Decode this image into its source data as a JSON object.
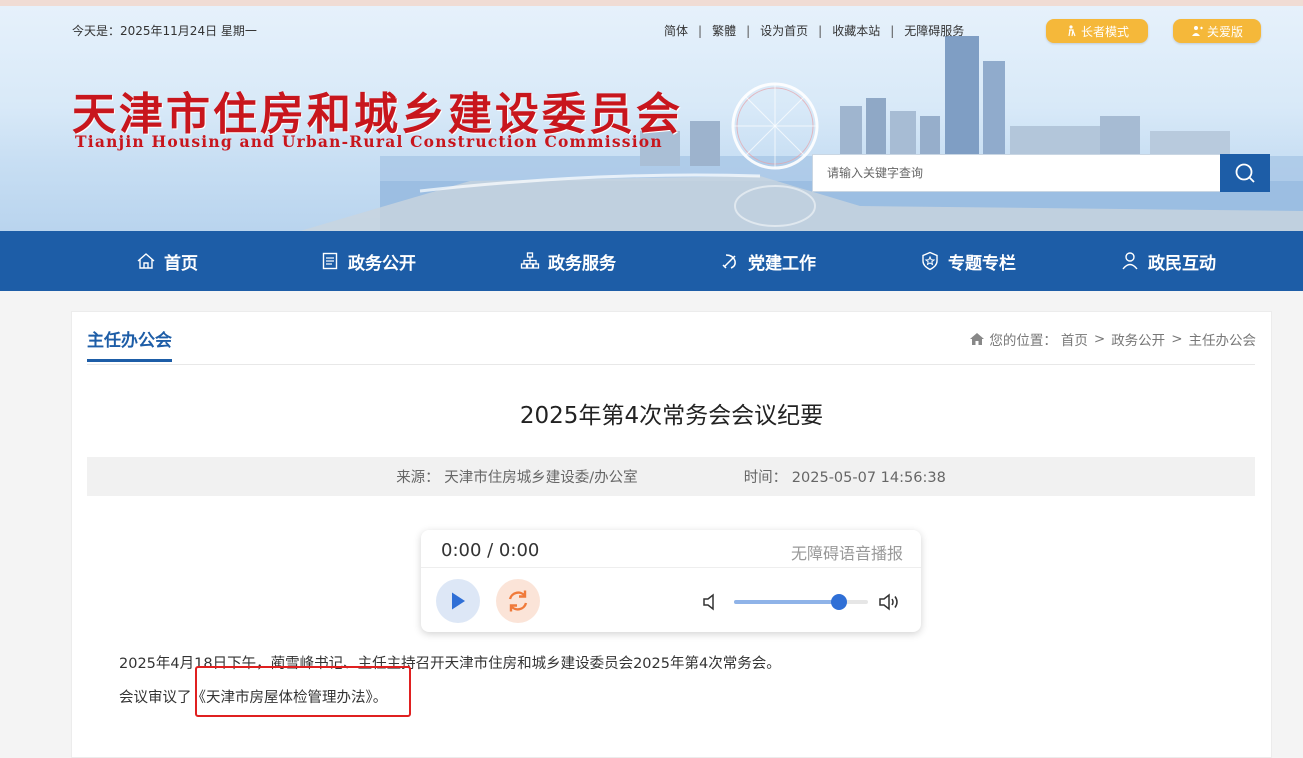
{
  "topbar": {
    "date": "今天是：2025年11月24日 星期一",
    "links": [
      "简体",
      "繁體",
      "设为首页",
      "收藏本站",
      "无障碍服务"
    ],
    "elder_mode": "长者模式",
    "care_version": "关爱版"
  },
  "logo": {
    "cn": "天津市住房和城乡建设委员会",
    "en": "Tianjin Housing and Urban-Rural Construction Commission"
  },
  "search": {
    "placeholder": "请输入关键字查询",
    "icon": "search-icon"
  },
  "nav": [
    {
      "label": "首页",
      "icon": "home-icon"
    },
    {
      "label": "政务公开",
      "icon": "document-icon"
    },
    {
      "label": "政务服务",
      "icon": "org-chart-icon"
    },
    {
      "label": "党建工作",
      "icon": "party-emblem-icon"
    },
    {
      "label": "专题专栏",
      "icon": "badge-star-icon"
    },
    {
      "label": "政民互动",
      "icon": "person-icon"
    }
  ],
  "section": {
    "tab": "主任办公会"
  },
  "breadcrumb": {
    "prefix": "您的位置：",
    "items": [
      "首页",
      "政务公开",
      "主任办公会"
    ],
    "separator": ">"
  },
  "article": {
    "title": "2025年第4次常务会会议纪要",
    "source": "来源：  天津市住房城乡建设委/办公室",
    "time": "时间：  2025-05-07 14:56:38",
    "paragraphs": [
      "2025年4月18日下午，蔺雪峰书记、主任主持召开天津市住房和城乡建设委员会2025年第4次常务会。",
      "会议审议了《天津市房屋体检管理办法》。"
    ]
  },
  "player": {
    "time": "0:00 / 0:00",
    "label": "无障碍语音播报",
    "volume": 0.78
  },
  "colors": {
    "brand_blue": "#1d5da7",
    "logo_red": "#c8161d",
    "pill_orange": "#f5b83a",
    "highlight_red": "#e02020"
  }
}
